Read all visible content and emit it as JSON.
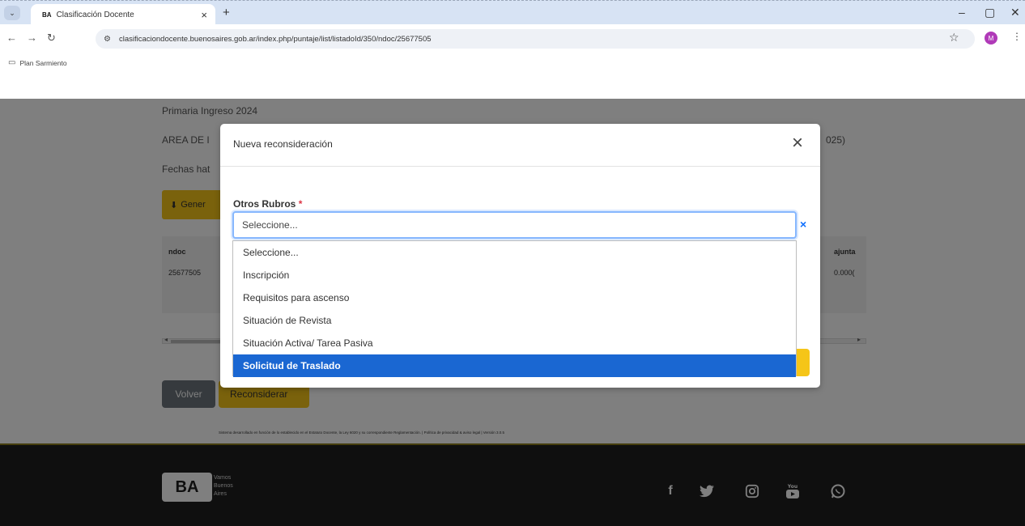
{
  "browser": {
    "tab_favicon": "BA",
    "tab_title": "Clasificación Docente",
    "tab_close": "×",
    "new_tab": "+",
    "tab_list_icon": "⌄",
    "url": "clasificaciondocente.buenosaires.gob.ar/index.php/puntaje/list/listadoId/350/ndoc/25677505",
    "profile_initial": "M",
    "bookmark_label": "Plan Sarmiento",
    "window_controls": [
      "–",
      "▢",
      "✕"
    ]
  },
  "page": {
    "line1": "Primaria Ingreso 2024",
    "line2": "AREA DE I",
    "line2_right": "025)",
    "line3": "Fechas hat",
    "generate_button": "Gener",
    "table": {
      "headers": [
        "ndoc",
        "ajunta"
      ],
      "row": [
        "25677505",
        "0.000("
      ]
    },
    "volver_button": "Volver",
    "reconsiderar_button": "Reconsiderar",
    "footnote": "Sistema desarrollado en función de lo establecido en el Estatuto Docente, la Ley 6020 y su correspondiente Reglamentación. | Política de privacidad & aviso legal | Versión 3.0.5"
  },
  "footer": {
    "logo_text": "BA",
    "logo_tagline": [
      "Vamos",
      "Buenos",
      "Aires"
    ],
    "social_icons": [
      "facebook-icon",
      "twitter-icon",
      "instagram-icon",
      "youtube-icon",
      "whatsapp-icon"
    ],
    "social_glyphs": {
      "facebook": "f",
      "twitter": "🐦",
      "instagram": "◎",
      "youtube": "▶",
      "whatsapp": "✆"
    }
  },
  "modal": {
    "title": "Nueva reconsideración",
    "close_glyph": "×",
    "field_label": "Otros Rubros",
    "required_mark": "*",
    "select_value": "Seleccione...",
    "clear_glyph": "×",
    "options": [
      "Seleccione...",
      "Inscripción",
      "Requisitos para ascenso",
      "Situación de Revista",
      "Situación Activa/ Tarea Pasiva",
      "Solicitud de Traslado"
    ],
    "highlighted_option": "Solicitud de Traslado"
  },
  "colors": {
    "accent_yellow": "#f5c518",
    "selection_blue": "#1a67d2",
    "focus_blue": "#86b7fe"
  }
}
